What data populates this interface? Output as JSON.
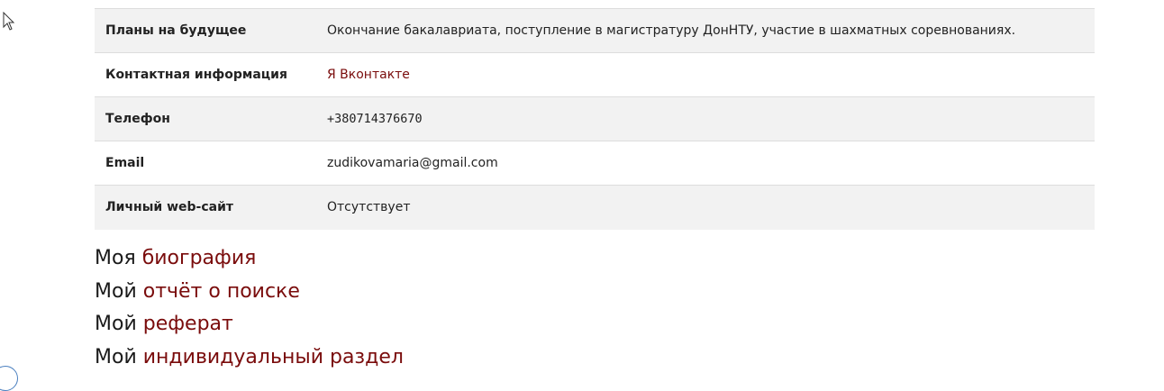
{
  "table": {
    "rows": [
      {
        "label": "Планы на будущее",
        "value": "Окончание бакалавриата, поступление в магистратуру ДонНТУ, участие в шахматных соревнованиях."
      },
      {
        "label": "Контактная информация",
        "value": "Я Вконтакте"
      },
      {
        "label": "Телефон",
        "value": "+380714376670"
      },
      {
        "label": "Email",
        "value": "zudikovamaria@gmail.com"
      },
      {
        "label": "Личный web-сайт",
        "value": "Отсутствует"
      }
    ]
  },
  "links": [
    {
      "prefix": "Моя",
      "link": "биография"
    },
    {
      "prefix": "Мой",
      "link": "отчёт о поиске"
    },
    {
      "prefix": "Мой",
      "link": "реферат"
    },
    {
      "prefix": "Мой",
      "link": "индивидуальный раздел"
    }
  ],
  "colors": {
    "link": "#7a0c0c",
    "row_stripe": "#f2f2f2",
    "text": "#222222"
  }
}
